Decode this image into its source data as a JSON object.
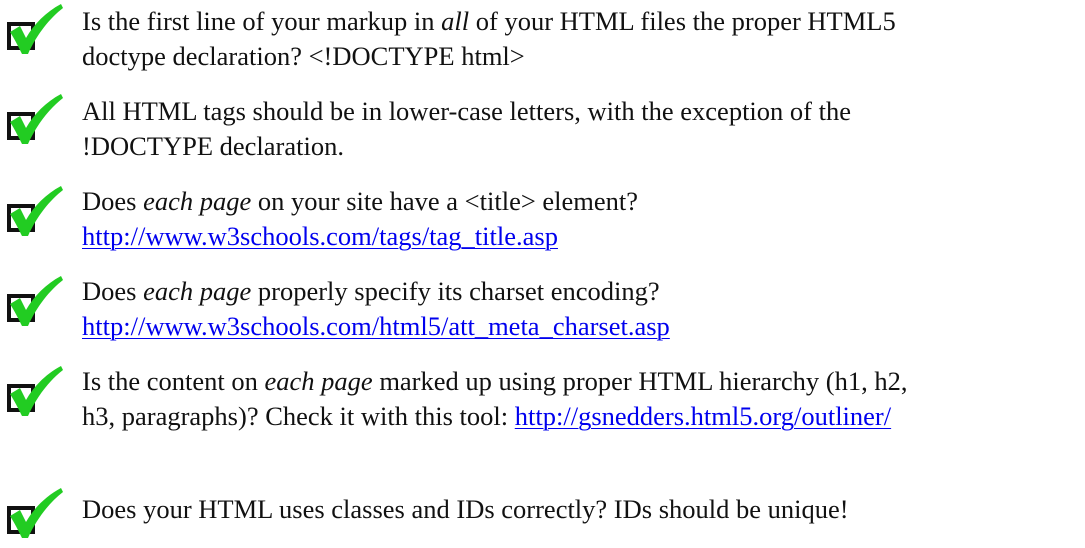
{
  "colors": {
    "check_green": "#22cc22",
    "box_stroke": "#111111",
    "link": "#0000ee",
    "text": "#111111"
  },
  "checklist": [
    {
      "icon": "checkmark-icon",
      "line1": {
        "a": "Is the first line of your markup in ",
        "em": "all",
        "b": " of your HTML files the proper HTML5"
      },
      "line2": {
        "a": "doctype declaration?  <!DOCTYPE html>"
      }
    },
    {
      "icon": "checkmark-icon",
      "line1": {
        "a": "All HTML tags should be in lower-case letters, with the exception of the"
      },
      "line2": {
        "a": "!DOCTYPE declaration."
      }
    },
    {
      "icon": "checkmark-icon",
      "line1": {
        "a": "Does ",
        "em": "each page",
        "b": " on your site have a <title> element?"
      },
      "line2": {
        "link": "http://www.w3schools.com/tags/tag_title.asp"
      }
    },
    {
      "icon": "checkmark-icon",
      "line1": {
        "a": "Does ",
        "em": "each page",
        "b": " properly specify its charset encoding?"
      },
      "line2": {
        "link": "http://www.w3schools.com/html5/att_meta_charset.asp"
      }
    },
    {
      "icon": "checkmark-icon",
      "line1": {
        "a": "Is the content on ",
        "em": "each page",
        "b": " marked up using proper HTML hierarchy (h1, h2,"
      },
      "line2": {
        "a": "h3, paragraphs)?  Check it with this tool:  ",
        "link": "http://gsnedders.html5.org/outliner/"
      }
    },
    {
      "icon": "checkmark-icon",
      "line1": {
        "a": "Does your HTML uses classes and IDs correctly?  IDs should be unique!"
      }
    }
  ]
}
